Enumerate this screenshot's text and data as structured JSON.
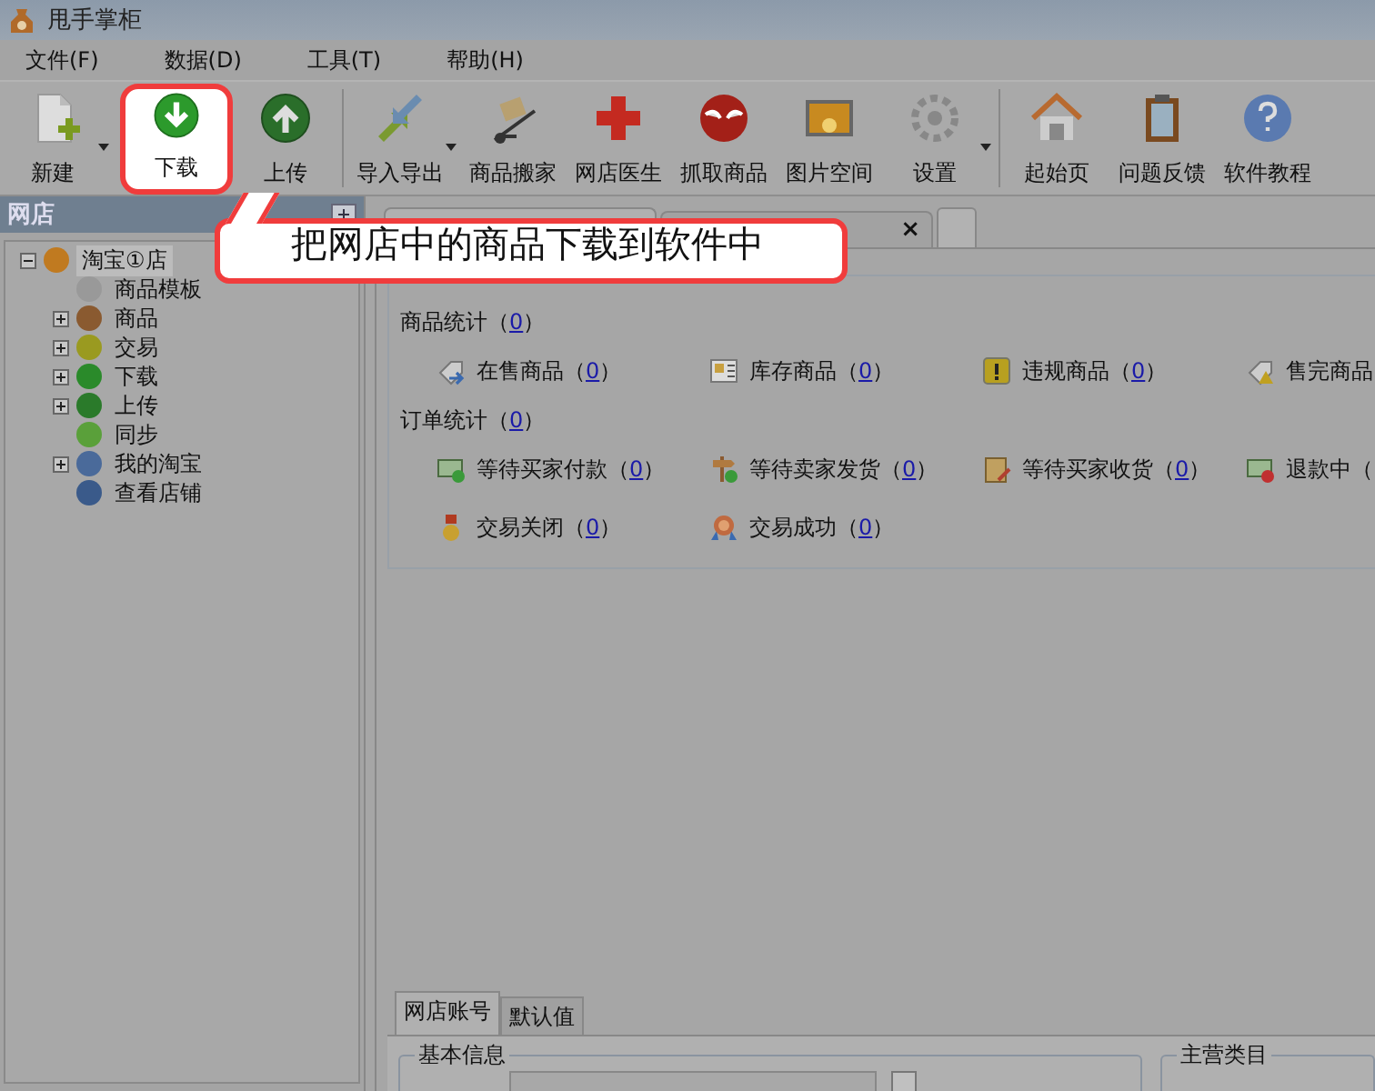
{
  "window": {
    "title": "甩手掌柜"
  },
  "menu": [
    {
      "label": "文件(F)"
    },
    {
      "label": "数据(D)"
    },
    {
      "label": "工具(T)"
    },
    {
      "label": "帮助(H)"
    }
  ],
  "toolbar": [
    [
      {
        "label": "新建",
        "has_menu": true,
        "highlighted": false
      },
      {
        "label": "下载",
        "has_menu": false,
        "highlighted": true
      },
      {
        "label": "上传",
        "has_menu": false,
        "highlighted": false
      }
    ],
    [
      {
        "label": "导入导出",
        "has_menu": true,
        "highlighted": false
      },
      {
        "label": "商品搬家",
        "has_menu": false,
        "highlighted": false
      },
      {
        "label": "网店医生",
        "has_menu": false,
        "highlighted": false
      },
      {
        "label": "抓取商品",
        "has_menu": false,
        "highlighted": false
      },
      {
        "label": "图片空间",
        "has_menu": false,
        "highlighted": false
      },
      {
        "label": "设置",
        "has_menu": true,
        "highlighted": false
      }
    ],
    [
      {
        "label": "起始页",
        "has_menu": false,
        "highlighted": false
      },
      {
        "label": "问题反馈",
        "has_menu": false,
        "highlighted": false
      },
      {
        "label": "软件教程",
        "has_menu": false,
        "highlighted": false
      }
    ]
  ],
  "callout": {
    "text": "把网店中的商品下载到软件中"
  },
  "sidebar": {
    "title": "网店",
    "tree": [
      {
        "label": "淘宝①店",
        "expanded": true,
        "selected": true,
        "children": [
          {
            "label": "商品模板",
            "selected": false
          },
          {
            "label": "商品",
            "expanded": false,
            "selected": false
          },
          {
            "label": "交易",
            "expanded": false,
            "selected": false
          },
          {
            "label": "下载",
            "expanded": false,
            "selected": false
          },
          {
            "label": "上传",
            "expanded": false,
            "selected": false
          },
          {
            "label": "同步",
            "selected": false
          },
          {
            "label": "我的淘宝",
            "expanded": false,
            "selected": false
          },
          {
            "label": "查看店铺",
            "selected": false
          }
        ]
      }
    ]
  },
  "doc_tabs": [
    {
      "selected": true
    },
    {
      "selected": false,
      "close": "×"
    }
  ],
  "stats": {
    "product": {
      "label": "商品统计（",
      "count": "0",
      "end": "）",
      "items": [
        {
          "label": "在售商品（",
          "count": "0",
          "end": "）"
        },
        {
          "label": "库存商品（",
          "count": "0",
          "end": "）"
        },
        {
          "label": "违规商品（",
          "count": "0",
          "end": "）"
        },
        {
          "label": "售完商品"
        }
      ]
    },
    "order": {
      "label": "订单统计（",
      "count": "0",
      "end": "）",
      "items": [
        {
          "label": "等待买家付款（",
          "count": "0",
          "end": "）"
        },
        {
          "label": "等待卖家发货（",
          "count": "0",
          "end": "）"
        },
        {
          "label": "等待买家收货（",
          "count": "0",
          "end": "）"
        },
        {
          "label": "退款中（"
        },
        {
          "label": "交易关闭（",
          "count": "0",
          "end": "）"
        },
        {
          "label": "交易成功（",
          "count": "0",
          "end": "）"
        }
      ]
    }
  },
  "bottom_tabs": [
    {
      "label": "网店账号",
      "selected": true
    },
    {
      "label": "默认值",
      "selected": false
    }
  ],
  "groups": [
    {
      "title": "基本信息",
      "checkbox": {
        "checked": false
      }
    },
    {
      "title": "主营类目"
    }
  ]
}
